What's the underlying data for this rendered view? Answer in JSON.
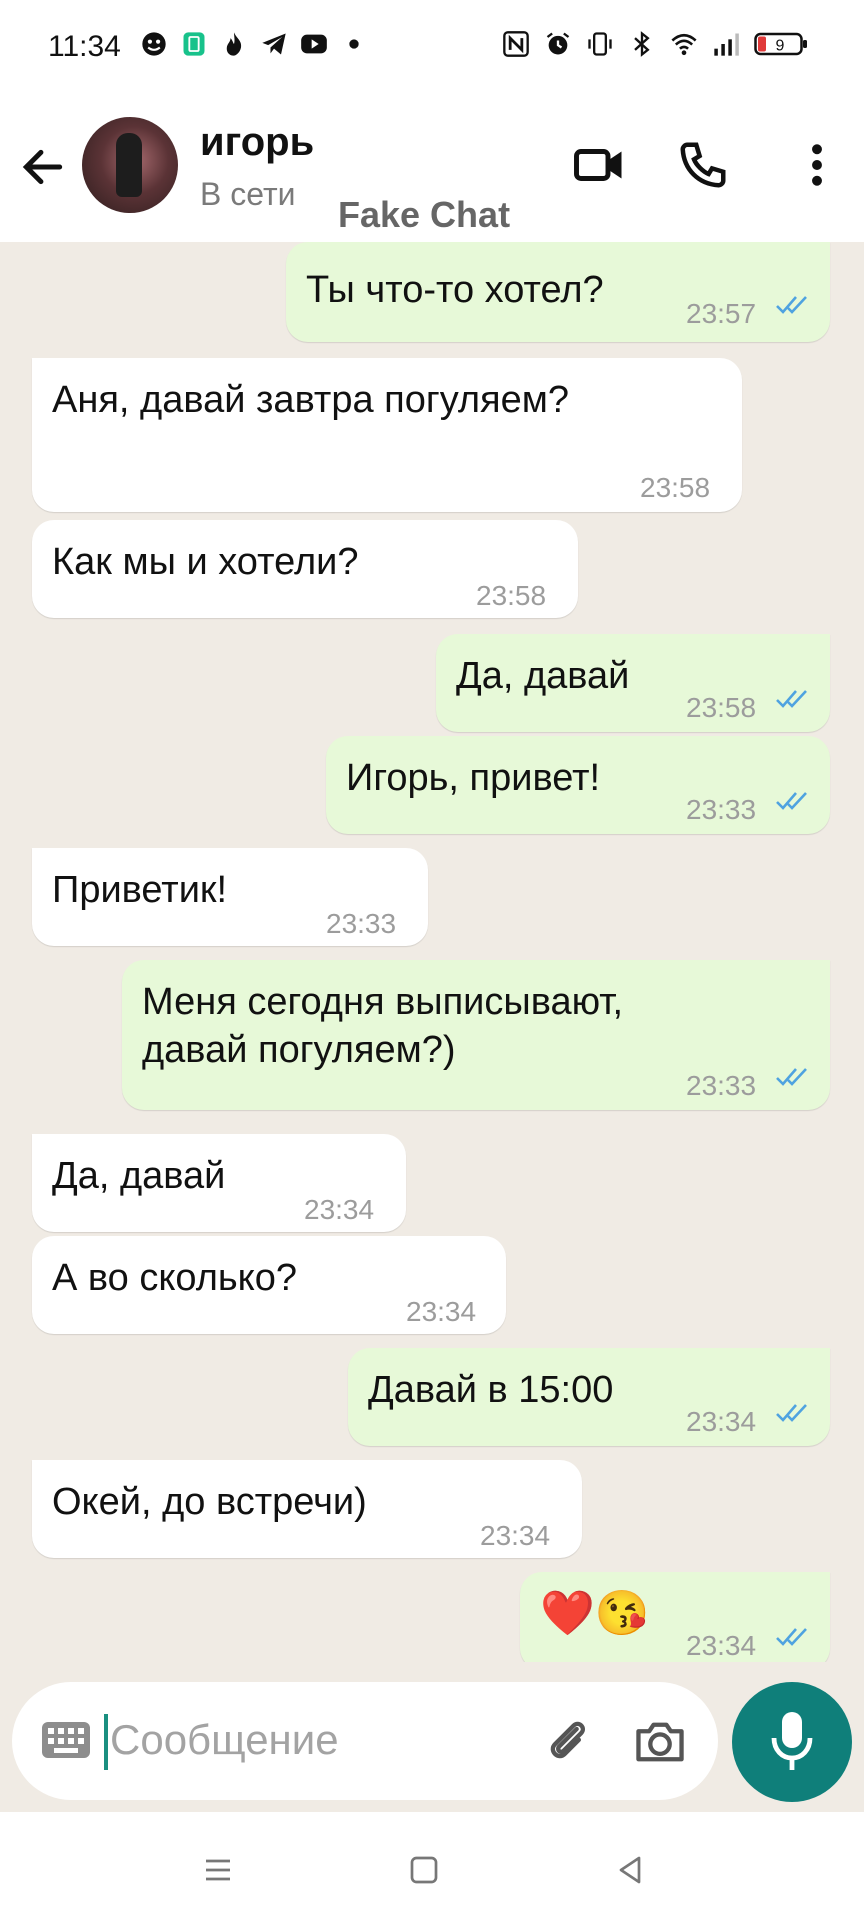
{
  "statusbar": {
    "time": "11:34",
    "left_icons": [
      "face-icon",
      "battery-saver-icon",
      "flame-icon",
      "telegram-icon",
      "youtube-icon",
      "dot-icon"
    ],
    "right_icons": [
      "nfc-icon",
      "alarm-icon",
      "vibrate-icon",
      "bluetooth-icon",
      "wifi-icon",
      "signal-icon",
      "battery-icon"
    ],
    "battery": "9"
  },
  "header": {
    "name": "игорь",
    "status": "В сети",
    "watermark": "Fake Chat",
    "icons": [
      "back-arrow-icon",
      "video-call-icon",
      "phone-icon",
      "more-vert-icon"
    ]
  },
  "messages": [
    {
      "dir": "out",
      "text": "Ты что-то хотел?",
      "time": "23:57",
      "read": true
    },
    {
      "dir": "in",
      "text": "Аня, давай завтра погуляем?",
      "time": "23:58"
    },
    {
      "dir": "in",
      "text": "Как мы и хотели?",
      "time": "23:58"
    },
    {
      "dir": "out",
      "text": "Да, давай",
      "time": "23:58",
      "read": true
    },
    {
      "dir": "out",
      "text": "Игорь, привет!",
      "time": "23:33",
      "read": true
    },
    {
      "dir": "in",
      "text": "Приветик!",
      "time": "23:33"
    },
    {
      "dir": "out",
      "text": "Меня сегодня выписывают,\nдавай погуляем?)",
      "time": "23:33",
      "read": true
    },
    {
      "dir": "in",
      "text": "Да, давай",
      "time": "23:34"
    },
    {
      "dir": "in",
      "text": "А во сколько?",
      "time": "23:34"
    },
    {
      "dir": "out",
      "text": "Давай в 15:00",
      "time": "23:34",
      "read": true
    },
    {
      "dir": "in",
      "text": "Окей, до встречи)",
      "time": "23:34"
    },
    {
      "dir": "out",
      "text": "❤️😘",
      "time": "23:34",
      "read": true
    }
  ],
  "input": {
    "placeholder": "Сообщение",
    "icons": [
      "keyboard-icon",
      "attach-icon",
      "camera-icon",
      "mic-icon"
    ]
  },
  "colors": {
    "outgoing_bubble": "#e7f9d8",
    "incoming_bubble": "#ffffff",
    "read_ticks": "#4fa3e0",
    "mic_button": "#0f7f7a",
    "chat_bg": "#f0ebe4"
  },
  "navbar": {
    "icons": [
      "menu-nav-icon",
      "home-nav-icon",
      "back-nav-icon"
    ]
  }
}
